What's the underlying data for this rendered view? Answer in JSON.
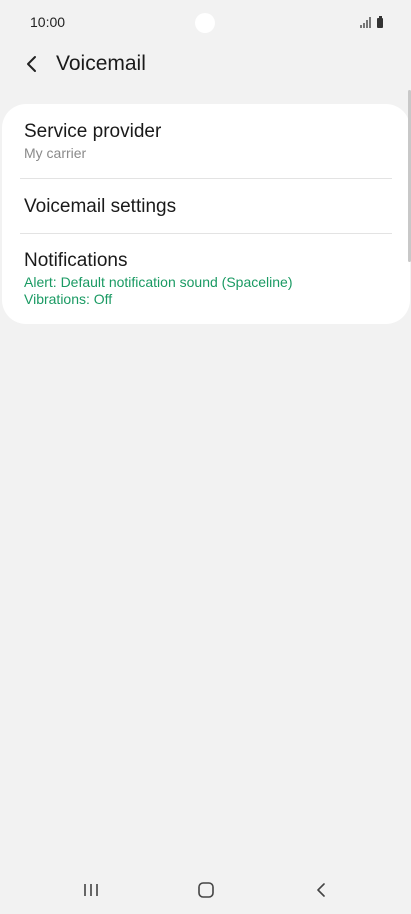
{
  "status_bar": {
    "time": "10:00"
  },
  "header": {
    "title": "Voicemail",
    "back_icon": "chevron-left-icon"
  },
  "settings": {
    "items": [
      {
        "title": "Service provider",
        "subtitle": "My carrier"
      },
      {
        "title": "Voicemail settings"
      },
      {
        "title": "Notifications",
        "subtitle_lines": [
          "Alert: Default notification sound (Spaceline)",
          "Vibrations: Off"
        ]
      }
    ]
  },
  "colors": {
    "background": "#f2f2f2",
    "card": "#ffffff",
    "accent_green": "#1a9a63",
    "secondary_text": "#8a8a8a"
  },
  "nav_bar": {
    "icons": [
      "recent-apps-icon",
      "home-icon",
      "back-icon"
    ]
  }
}
